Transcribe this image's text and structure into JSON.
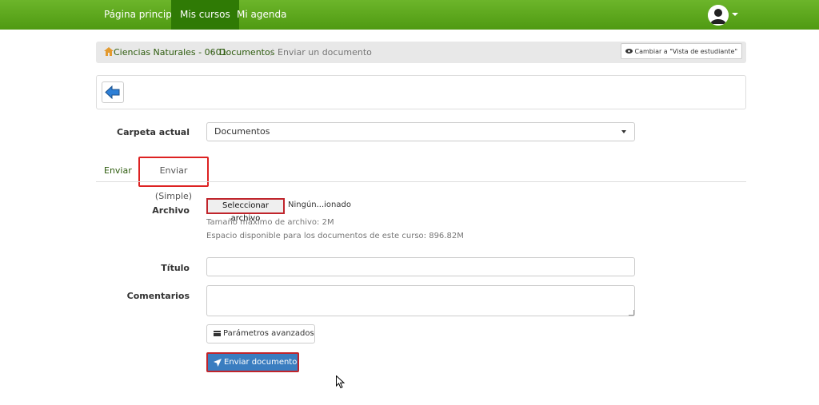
{
  "nav": {
    "items": [
      {
        "label": "Página principal"
      },
      {
        "label": "Mis cursos"
      },
      {
        "label": "Mi agenda"
      }
    ],
    "active_index": 1,
    "user_icon": "user-avatar-icon"
  },
  "breadcrumb": {
    "items": [
      "Ciencias Naturales - 0601",
      "Documentos",
      "Enviar un documento"
    ],
    "separator": "/",
    "home_icon": "home-icon"
  },
  "toolbar": {
    "student_view_label": "Cambiar a \"Vista de estudiante\"",
    "back_icon": "back-arrow-icon"
  },
  "form": {
    "folder_label": "Carpeta actual",
    "folder_value": "Documentos",
    "tabs": [
      "Enviar",
      "Enviar (Simple)"
    ],
    "active_tab": 1,
    "file_label": "Archivo",
    "file_button": "Seleccionar archivo",
    "file_status": "Ningún...ionado",
    "max_size": "Tamaño máximo de archivo: 2M",
    "space_available": "Espacio disponible para los documentos de este curso: 896.82M",
    "title_label": "Título",
    "title_value": "",
    "comments_label": "Comentarios",
    "comments_value": "",
    "advanced_button": "Parámetros avanzados",
    "submit_button": "Enviar documento"
  },
  "colors": {
    "nav_green": "#5aa81c",
    "nav_active": "#2f7a05",
    "highlight_red": "#c0242b",
    "primary_blue": "#3a7dc0",
    "link_green": "#2e5c0e"
  }
}
